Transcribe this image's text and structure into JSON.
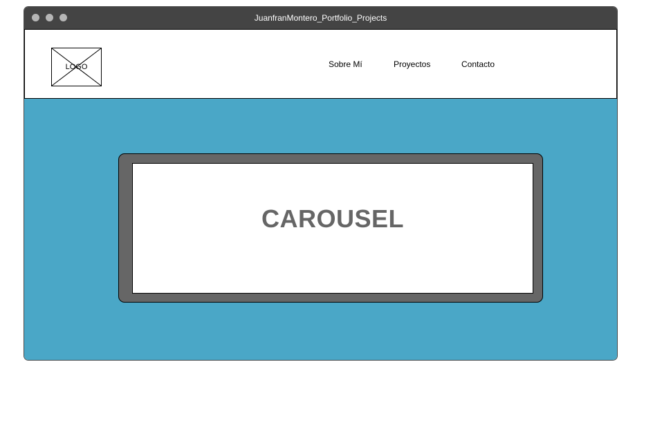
{
  "window": {
    "title": "JuanfranMontero_Portfolio_Projects"
  },
  "header": {
    "logo_label": "LOGO",
    "nav": [
      {
        "label": "Sobre Mí"
      },
      {
        "label": "Proyectos"
      },
      {
        "label": "Contacto"
      }
    ]
  },
  "hero": {
    "carousel_label": "CAROUSEL"
  },
  "colors": {
    "titlebar": "#444444",
    "hero_background": "#4aa7c7",
    "carousel_frame": "#666666",
    "carousel_text": "#666666"
  }
}
